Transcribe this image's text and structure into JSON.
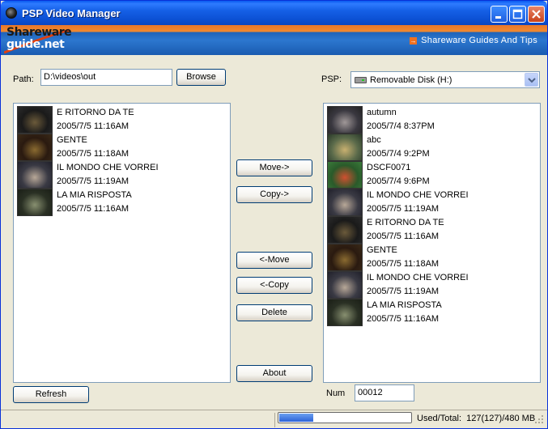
{
  "window": {
    "title": "PSP Video Manager"
  },
  "banner": {
    "logo_line1": "Shareware",
    "logo_line2": "guide.net",
    "link_text": "Shareware Guides And Tips"
  },
  "path": {
    "label": "Path:",
    "value": "D:\\videos\\out",
    "browse_label": "Browse"
  },
  "psp": {
    "label": "PSP:",
    "selected": "Removable Disk (H:)"
  },
  "local_list": [
    {
      "name": "E RITORNO DA TE",
      "date": "2005/7/5 11:16AM"
    },
    {
      "name": "GENTE",
      "date": "2005/7/5 11:18AM"
    },
    {
      "name": "IL MONDO CHE VORREI",
      "date": "2005/7/5 11:19AM"
    },
    {
      "name": "LA MIA RISPOSTA",
      "date": "2005/7/5 11:16AM"
    }
  ],
  "psp_list": [
    {
      "name": "autumn",
      "date": "2005/7/4 8:37PM"
    },
    {
      "name": "abc",
      "date": "2005/7/4 9:2PM"
    },
    {
      "name": "DSCF0071",
      "date": "2005/7/4 9:6PM"
    },
    {
      "name": "IL MONDO CHE VORREI",
      "date": "2005/7/5 11:19AM"
    },
    {
      "name": "E RITORNO DA TE",
      "date": "2005/7/5 11:16AM"
    },
    {
      "name": "GENTE",
      "date": "2005/7/5 11:18AM"
    },
    {
      "name": "IL MONDO CHE VORREI",
      "date": "2005/7/5 11:19AM"
    },
    {
      "name": "LA MIA RISPOSTA",
      "date": "2005/7/5 11:16AM"
    }
  ],
  "buttons": {
    "move_right": "Move->",
    "copy_right": "Copy->",
    "move_left": "<-Move",
    "copy_left": "<-Copy",
    "delete": "Delete",
    "about": "About",
    "refresh": "Refresh"
  },
  "num": {
    "label": "Num",
    "value": "00012"
  },
  "status": {
    "usage_fraction": 0.26,
    "used_total_label": "Used/Total:",
    "used_total_value": "127(127)/480 MB"
  },
  "colors": {
    "titlebar": "#0B4FD2",
    "banner_orange": "#F08A30",
    "banner_blue": "#2C77CF",
    "progress": "#2C63D8"
  }
}
